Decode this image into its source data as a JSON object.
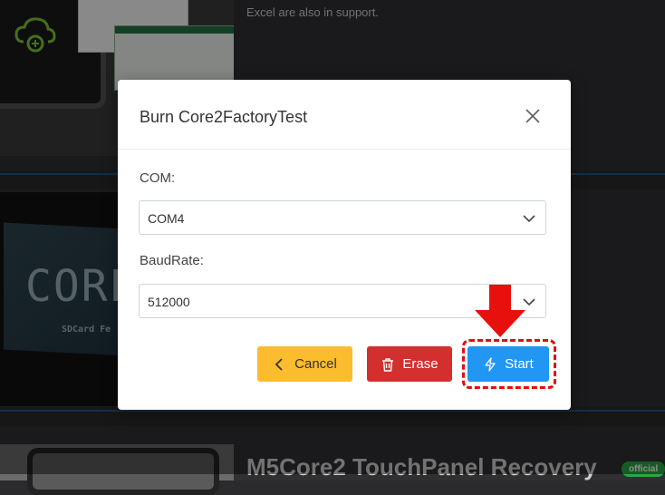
{
  "background": {
    "card1_text": "Excel are also in support.",
    "card2_screen_text": "CORE",
    "card2_sd_text": "SDCard Fe",
    "card3_title": "M5Core2 TouchPanel Recovery",
    "card3_badge": "official"
  },
  "modal": {
    "title": "Burn Core2FactoryTest",
    "com_label": "COM:",
    "com_value": "COM4",
    "baud_label": "BaudRate:",
    "baud_value": "512000",
    "buttons": {
      "cancel": "Cancel",
      "erase": "Erase",
      "start": "Start"
    }
  },
  "colors": {
    "cancel": "#fbbc2d",
    "erase": "#d32f2f",
    "start": "#2196f3",
    "highlight": "#e01010"
  },
  "icons": {
    "close": "close-icon",
    "chevron": "chevron-down-icon",
    "cancel": "chevron-left-icon",
    "erase": "trash-icon",
    "start": "lightning-icon",
    "annotation": "down-arrow-icon"
  }
}
